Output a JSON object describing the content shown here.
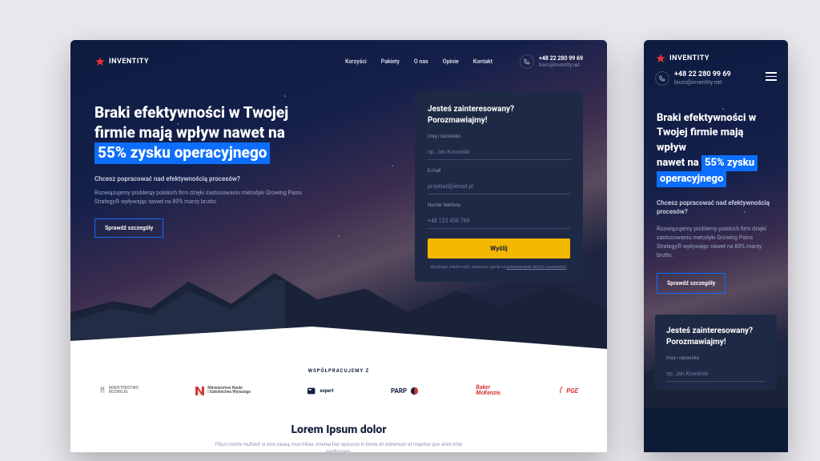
{
  "brand": "INVENTITY",
  "nav": [
    "Korzyści",
    "Pakiety",
    "O nas",
    "Opinie",
    "Kontakt"
  ],
  "contact": {
    "phone": "+48 22 280 99 69",
    "email": "biuro@inventity.net"
  },
  "hero": {
    "line1": "Braki efektywności w Twojej",
    "line2": "firmie mają wpływ nawet na",
    "highlight": "55% zysku operacyjnego",
    "sub": "Chcesz popracować nad efektywnością procesów?",
    "body": "Rozwiązujemy problemy polskich firm dzięki zastosowaniu metodyki Growing Pains Strategy® wpływając nawet na 80% marży brutto.",
    "cta": "Sprawdź szczegóły"
  },
  "form": {
    "title1": "Jesteś zainteresowany?",
    "title2": "Porozmawiajmy!",
    "f1_label": "Imię i nazwisko",
    "f1_ph": "np. Jan Kowalski",
    "f2_label": "E-mail",
    "f2_ph": "przykład@email.pl",
    "f3_label": "Numer telefonu",
    "f3_ph": "+48 123 456 789",
    "submit": "Wyślij",
    "disc_a": "Wysyłając wiadomość, wyrażasz zgodę na ",
    "disc_b": "przetwarzanie danych osobowych"
  },
  "collab": "WSPÓŁPRACUJEMY Z",
  "partners": {
    "p1_a": "MINISTERSTWO",
    "p1_b": "ROZWOJU",
    "p2_a": "Ministerstwo Nauki",
    "p2_b": "i Szkolnictwa Wyższego",
    "p3": "expert",
    "p4": "PARP",
    "p5_a": "Baker",
    "p5_b": "McKenzie.",
    "p6": "PGE"
  },
  "sec2": {
    "title": "Lorem Ipsum dolor",
    "body": "Fillum morte multavit si sine causa, mox bibes. Interea hoc epicurus in bonis sit extremum et impetus quo anim inter mediocrem."
  },
  "mobile": {
    "t1": "Braki efektywności w",
    "t2": "Twojej firmie mają wpływ",
    "t3": "nawet na",
    "hl1": "55% zysku",
    "hl2": "operacyjnego",
    "sub": "Chcesz popracować nad efektywnością procesów?",
    "body": "Rozwiązujemy problemy polskich firm dzięki zastosowaniu metodyki Growing Pains Strategy® wpływając nawet na 80% marży brutto."
  }
}
